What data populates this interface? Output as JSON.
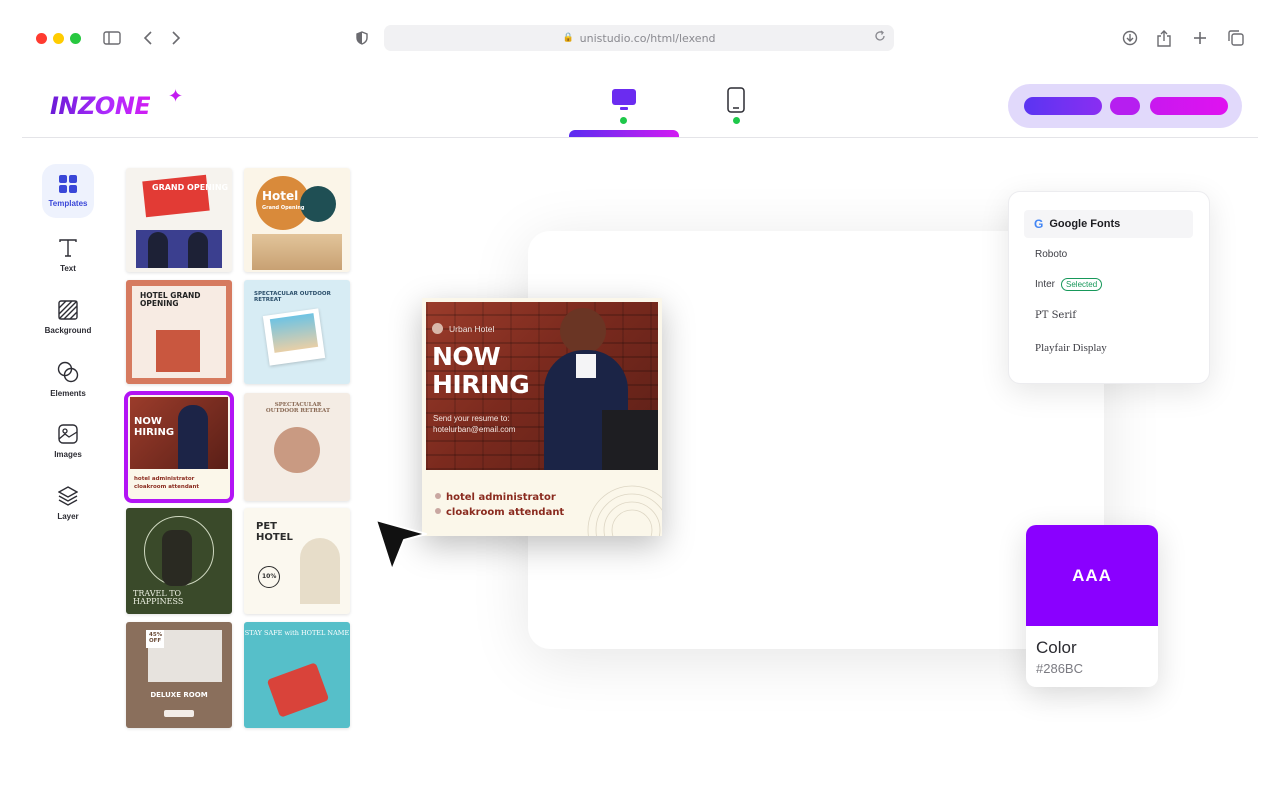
{
  "browser": {
    "url": "unistudio.co/html/lexend"
  },
  "app": {
    "logo": "INZONE",
    "devices": [
      "desktop-view",
      "mobile-view"
    ]
  },
  "sidebar": {
    "items": [
      {
        "label": "Templates",
        "icon": "grid-icon"
      },
      {
        "label": "Text",
        "icon": "text-icon"
      },
      {
        "label": "Background",
        "icon": "background-icon"
      },
      {
        "label": "Elements",
        "icon": "elements-icon"
      },
      {
        "label": "Images",
        "icon": "image-icon"
      },
      {
        "label": "Layer",
        "icon": "layers-icon"
      }
    ]
  },
  "templates": [
    {
      "title": "GRAND OPENING"
    },
    {
      "title": "Hotel",
      "subtitle": "Grand Opening"
    },
    {
      "title": "HOTEL GRAND OPENING"
    },
    {
      "title": "SPECTACULAR OUTDOOR RETREAT"
    },
    {
      "title": "NOW HIRING",
      "items": [
        "hotel administrator",
        "cloakroom attendant"
      ]
    },
    {
      "title": "SPECTACULAR OUTDOOR RETREAT"
    },
    {
      "title": "TRAVEL TO HAPPINESS"
    },
    {
      "title": "PET HOTEL",
      "badge": "10%"
    },
    {
      "title": "DELUXE ROOM",
      "badge": "45% OFF"
    },
    {
      "title": "STAY SAFE with HOTEL NAME"
    }
  ],
  "poster": {
    "brand": "Urban Hotel",
    "title_line1": "NOW",
    "title_line2": "HIRING",
    "sub_line1": "Send your resume to:",
    "sub_line2": "hotelurban@email.com",
    "items": [
      "hotel administrator",
      "cloakroom attendant"
    ]
  },
  "fonts_panel": {
    "header": "Google Fonts",
    "fonts": [
      "Roboto",
      "Inter",
      "PT Serif",
      "Playfair Display"
    ],
    "selected_badge": "Selected"
  },
  "color_panel": {
    "preview_text": "AAA",
    "label": "Color",
    "hex": "#286BC",
    "swatch_color": "#8a00ff"
  }
}
